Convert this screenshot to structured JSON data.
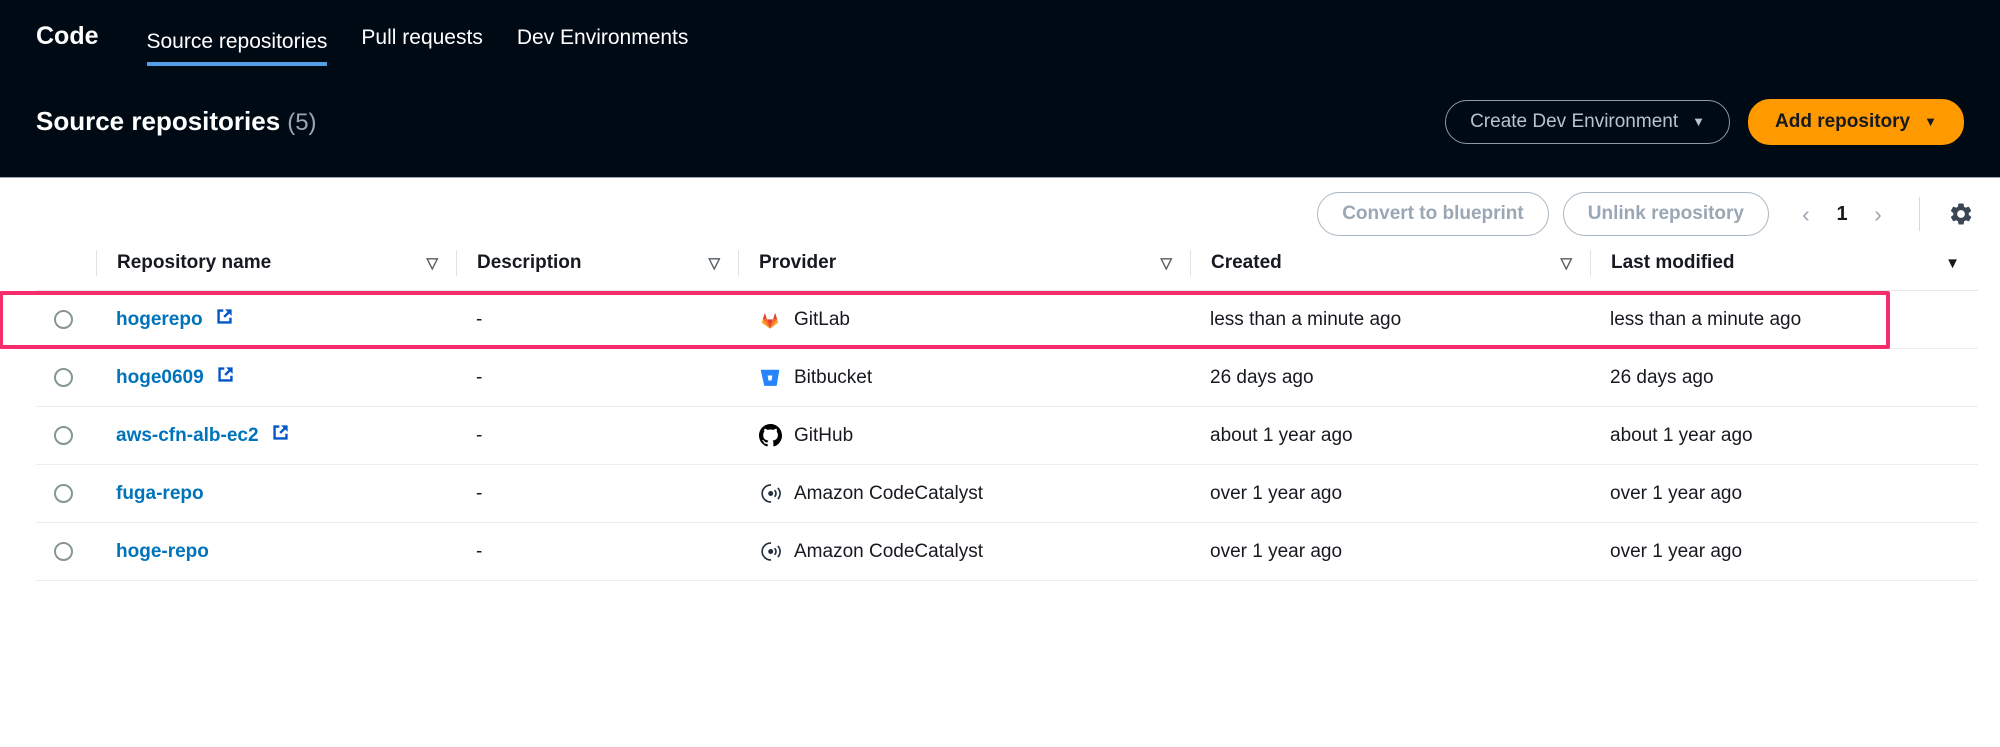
{
  "nav": {
    "brand": "Code",
    "tabs": [
      {
        "label": "Source repositories",
        "active": true
      },
      {
        "label": "Pull requests",
        "active": false
      },
      {
        "label": "Dev Environments",
        "active": false
      }
    ],
    "active_underline_color": "#539fe5"
  },
  "header": {
    "title": "Source repositories",
    "count": "(5)",
    "create_dev_environment_label": "Create Dev Environment",
    "add_repository_label": "Add repository",
    "caret_glyph": "▼",
    "primary_color": "#ff9900",
    "background_color": "#000a14"
  },
  "toolbar": {
    "convert_to_blueprint_label": "Convert to blueprint",
    "unlink_repository_label": "Unlink repository",
    "prev_glyph": "‹",
    "page_number": "1",
    "next_glyph": "›",
    "settings_icon": "gear-icon"
  },
  "table": {
    "columns": [
      {
        "label": "Repository name",
        "sort": "inactive"
      },
      {
        "label": "Description",
        "sort": "inactive"
      },
      {
        "label": "Provider",
        "sort": "inactive"
      },
      {
        "label": "Created",
        "sort": "inactive"
      },
      {
        "label": "Last modified",
        "sort": "active-desc"
      }
    ],
    "sort_inactive_glyph": "▽",
    "sort_active_glyph": "▼",
    "rows": [
      {
        "name": "hogerepo",
        "external_link": true,
        "description": "-",
        "provider": "GitLab",
        "provider_icon": "gitlab-icon",
        "created": "less than a minute ago",
        "last_modified": "less than a minute ago",
        "highlighted": true
      },
      {
        "name": "hoge0609",
        "external_link": true,
        "description": "-",
        "provider": "Bitbucket",
        "provider_icon": "bitbucket-icon",
        "created": "26 days ago",
        "last_modified": "26 days ago",
        "highlighted": false
      },
      {
        "name": "aws-cfn-alb-ec2",
        "external_link": true,
        "description": "-",
        "provider": "GitHub",
        "provider_icon": "github-icon",
        "created": "about 1 year ago",
        "last_modified": "about 1 year ago",
        "highlighted": false
      },
      {
        "name": "fuga-repo",
        "external_link": false,
        "description": "-",
        "provider": "Amazon CodeCatalyst",
        "provider_icon": "codecatalyst-icon",
        "created": "over 1 year ago",
        "last_modified": "over 1 year ago",
        "highlighted": false
      },
      {
        "name": "hoge-repo",
        "external_link": false,
        "description": "-",
        "provider": "Amazon CodeCatalyst",
        "provider_icon": "codecatalyst-icon",
        "created": "over 1 year ago",
        "last_modified": "over 1 year ago",
        "highlighted": false
      }
    ],
    "highlight_color": "#f52e6b",
    "link_color": "#0073bb"
  }
}
